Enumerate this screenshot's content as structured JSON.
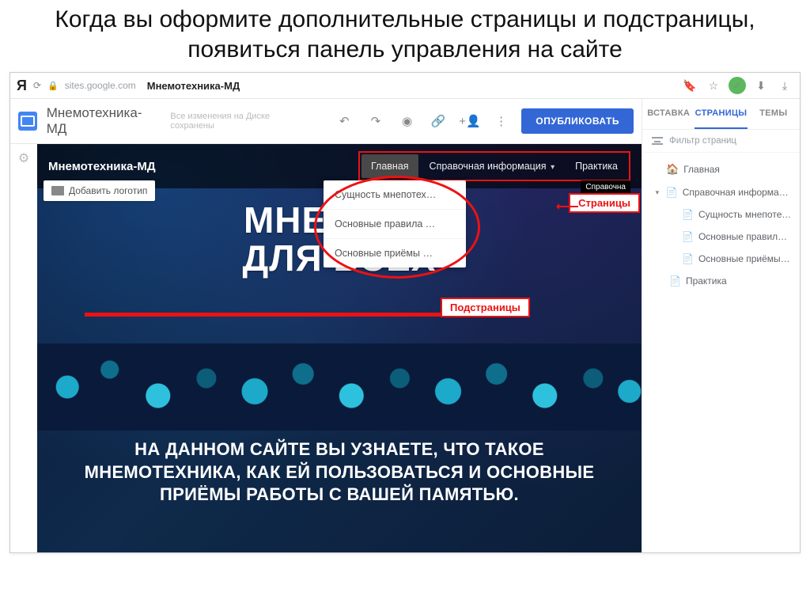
{
  "slide_title": "Когда вы оформите дополнительные страницы и подстраницы, появиться панель управления на сайте",
  "address_bar": {
    "yandex_logo": "Я",
    "domain": "sites.google.com",
    "tab_title": "Мнемотехника-МД"
  },
  "app_toolbar": {
    "doc_name": "Мнемотехника-МД",
    "save_message": "Все изменения на Диске сохранены",
    "publish_label": "ОПУБЛИКОВАТЬ"
  },
  "canvas": {
    "header_title": "Мнемотехника-МД",
    "nav": {
      "items": [
        {
          "label": "Главная",
          "active": true
        },
        {
          "label": "Справочная информация",
          "has_children": true
        },
        {
          "label": "Практика"
        }
      ]
    },
    "add_logo_label": "Добавить логотип",
    "tooltip": "Справочна",
    "dropdown": [
      "Сущность мнепотех…",
      "Основные правила …",
      "Основные приёмы …"
    ],
    "big_title_l1": "МНЕМОТЕ",
    "big_title_l2": "ДЛЯ ВСЕХ",
    "hero_sub": "НА ДАННОМ САЙТЕ ВЫ УЗНАЕТЕ, ЧТО ТАКОЕ МНЕМОТЕХНИКА, КАК ЕЙ ПОЛЬЗОВАТЬСЯ И ОСНОВНЫЕ ПРИЁМЫ РАБОТЫ С ВАШЕЙ ПАМЯТЬЮ."
  },
  "annotations": {
    "pages_tag": "Страницы",
    "subpages_tag": "Подстраницы"
  },
  "side_panel": {
    "tabs": [
      {
        "label": "ВСТАВКА"
      },
      {
        "label": "СТРАНИЦЫ",
        "active": true
      },
      {
        "label": "ТЕМЫ"
      }
    ],
    "filter_placeholder": "Фильтр страниц",
    "tree": {
      "home": "Главная",
      "ref": "Справочная информация",
      "children": [
        "Сущность мнепотехники",
        "Основные правила мне…",
        "Основные приёмы мне…"
      ],
      "practice": "Практика"
    }
  }
}
